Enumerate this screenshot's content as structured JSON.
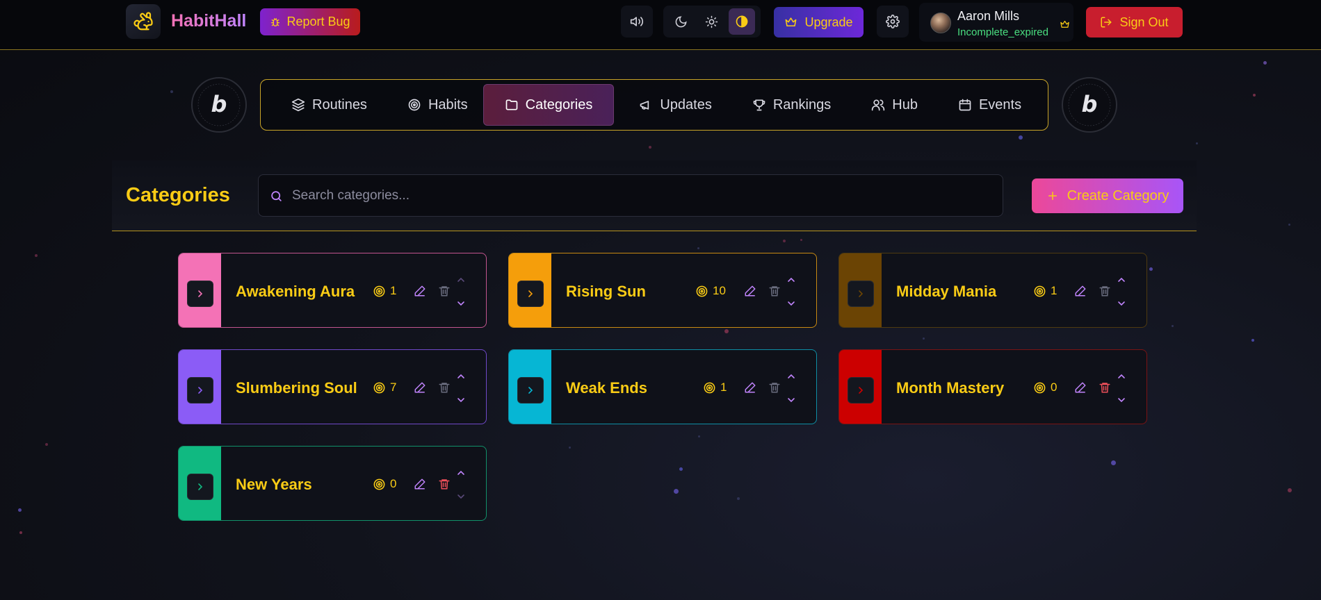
{
  "app": {
    "name": "HabitHall",
    "report_bug": "Report Bug"
  },
  "toolbar": {
    "upgrade": "Upgrade",
    "sign_out": "Sign Out"
  },
  "user": {
    "name": "Aaron Mills",
    "status": "Incomplete_expired"
  },
  "nav": {
    "items": [
      {
        "label": "Routines",
        "icon": "layers-icon"
      },
      {
        "label": "Habits",
        "icon": "target-icon"
      },
      {
        "label": "Categories",
        "icon": "folder-icon",
        "active": true
      },
      {
        "label": "Updates",
        "icon": "megaphone-icon"
      },
      {
        "label": "Rankings",
        "icon": "trophy-icon"
      },
      {
        "label": "Hub",
        "icon": "users-icon"
      },
      {
        "label": "Events",
        "icon": "calendar-icon"
      }
    ]
  },
  "header": {
    "title": "Categories",
    "search_placeholder": "Search categories...",
    "create_label": "Create Category"
  },
  "categories": [
    {
      "name": "Awakening Aura",
      "count": "1",
      "color": "#f472b6",
      "border": "#c2558f",
      "trash_red": false
    },
    {
      "name": "Rising Sun",
      "count": "10",
      "color": "#f59e0b",
      "border": "#c98a12",
      "trash_red": false
    },
    {
      "name": "Midday Mania",
      "count": "1",
      "color": "#6b4404",
      "border": "#4f3a10",
      "trash_red": false
    },
    {
      "name": "Slumbering Soul",
      "count": "7",
      "color": "#8b5cf6",
      "border": "#7049c9",
      "trash_red": false
    },
    {
      "name": "Weak Ends",
      "count": "1",
      "color": "#06b6d4",
      "border": "#0e8ea5",
      "trash_red": false
    },
    {
      "name": "Month Mastery",
      "count": "0",
      "color": "#cc0000",
      "border": "#7a1414",
      "trash_red": true
    },
    {
      "name": "New Years",
      "count": "0",
      "color": "#10b981",
      "border": "#11916a",
      "trash_red": true
    }
  ],
  "colors": {
    "accent_yellow": "#facc15",
    "accent_purple": "#a855f7"
  }
}
